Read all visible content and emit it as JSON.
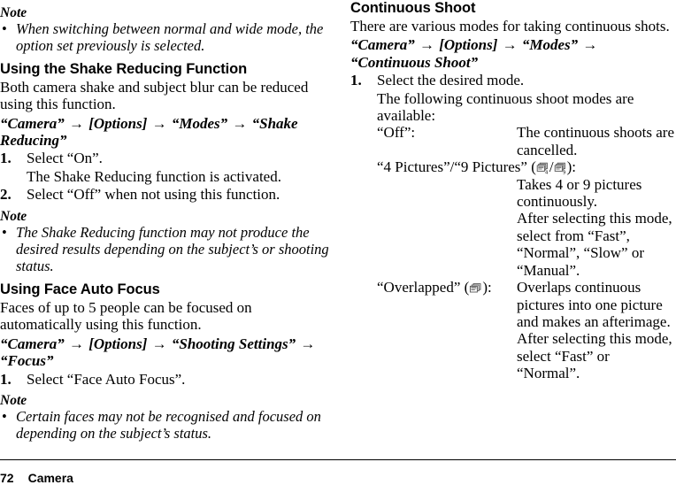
{
  "footer": {
    "page_number": "72",
    "chapter": "Camera"
  },
  "arrow": "→",
  "bullet": "•",
  "left_column": {
    "note_1": {
      "title": "Note",
      "items": [
        "When switching between normal and wide mode, the option set previously is selected."
      ]
    },
    "section_shake": {
      "heading": "Using the Shake Reducing Function",
      "intro": "Both camera shake and subject blur can be reduced using this function.",
      "navpath": [
        "“Camera”",
        "[Options]",
        "“Modes”",
        "“Shake Reducing”"
      ],
      "steps": [
        {
          "num": "1.",
          "text": "Select “On”."
        },
        {
          "num": "2.",
          "text": "Select “Off” when not using this function."
        }
      ],
      "substep_after_1": "The Shake Reducing function is activated."
    },
    "note_2": {
      "title": "Note",
      "items": [
        "The Shake Reducing function may not produce the desired results depending on the subject’s or shooting status."
      ]
    },
    "section_face": {
      "heading": "Using Face Auto Focus",
      "intro": "Faces of up to 5 people can be focused on automatically using this function.",
      "navpath": [
        "“Camera”",
        "[Options]",
        "“Shooting Settings”",
        "“Focus”"
      ],
      "steps": [
        {
          "num": "1.",
          "text": "Select “Face Auto Focus”."
        }
      ]
    },
    "note_3": {
      "title": "Note",
      "items": [
        "Certain faces may not be recognised and focused on depending on the subject’s status."
      ]
    }
  },
  "right_column": {
    "heading": "Continuous Shoot",
    "intro": "There are various modes for taking continuous shots.",
    "navpath": [
      "“Camera”",
      "[Options]",
      "“Modes”",
      "“Continuous Shoot”"
    ],
    "steps": [
      {
        "num": "1.",
        "text": "Select the desired mode."
      }
    ],
    "substep_after_1": "The following continuous shoot modes are available:",
    "modes": [
      {
        "term": "“Off”:",
        "icons": [],
        "description": "The continuous shoots are cancelled."
      },
      {
        "term_prefix": "“4 Pictures”/“9 Pictures” (",
        "term_suffix": "):",
        "icons": [
          "stacked-pictures-4-icon",
          "stacked-pictures-9-icon"
        ],
        "icon_separator": "/",
        "description_lines": [
          "Takes 4 or 9 pictures continuously.",
          "After selecting this mode, select from “Fast”, “Normal”, “Slow” or “Manual”."
        ]
      },
      {
        "term_prefix": "“Overlapped” (",
        "term_suffix": "):",
        "icons": [
          "overlapped-pictures-icon"
        ],
        "description_lines": [
          "Overlaps continuous pictures into one picture and makes an afterimage.",
          "After selecting this mode, select “Fast” or “Normal”."
        ]
      }
    ]
  }
}
